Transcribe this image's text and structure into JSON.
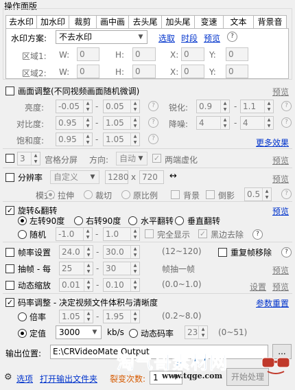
{
  "panel_title": "操作面版",
  "tabs": [
    "去水印",
    "加水印",
    "裁剪",
    "画中画",
    "去头尾",
    "加头尾",
    "变速",
    "文本",
    "背景音"
  ],
  "watermark_tab": {
    "scheme_label": "水印方案:",
    "scheme_value": "不去水印",
    "select_link": "选取",
    "time_link": "时段",
    "preview_link": "预览",
    "regions": [
      {
        "label": "区域1:",
        "w_label": "W:",
        "w": "0",
        "h_label": "H:",
        "h": "0",
        "x_label": "X:",
        "x": "0",
        "y_label": "Y:",
        "y": "0"
      },
      {
        "label": "区域2:",
        "w_label": "W:",
        "w": "0",
        "h_label": "H:",
        "h": "0",
        "x_label": "X:",
        "x": "0",
        "y_label": "Y:",
        "y": "0"
      }
    ]
  },
  "picture_adjust": {
    "label": "画面调整(不同视频画面随机微调)",
    "preview": "预览",
    "more": "更多效果",
    "brightness": {
      "label": "亮度:",
      "from": "-0.05",
      "to": "0.05"
    },
    "contrast": {
      "label": "对比度:",
      "from": "0.95",
      "to": "1.05"
    },
    "saturation": {
      "label": "饱和度:",
      "from": "0.95",
      "to": "1.05"
    },
    "sharpen": {
      "label": "锐化:",
      "from": "0.9",
      "to": "1.1"
    },
    "denoise": {
      "label": "降噪:",
      "from": "4",
      "to": "4"
    }
  },
  "grid_split": {
    "count": "3",
    "label": "宫格分屏",
    "direction_label": "方向:",
    "direction_value": "自动",
    "blur_label": "两端虚化",
    "preview": "预览"
  },
  "resolution": {
    "label": "分辨率",
    "preset": "自定义",
    "width": "1280",
    "times": "x",
    "height": "720",
    "preview": "预览",
    "mode_label": "模式:",
    "stretch": "拉伸",
    "crop": "裁切",
    "keep_ratio": "原比例",
    "background": "背景",
    "reflection": "倒影",
    "reflection_value": "0.5"
  },
  "rotate_flip": {
    "label": "旋转&翻转",
    "preview": "预览",
    "left90": "左转90度",
    "right90": "右转90度",
    "hflip": "水平翻转",
    "vflip": "垂直翻转",
    "random": "随机",
    "from": "-1.0",
    "to": "1.0",
    "full_display": "完全显示",
    "remove_black": "黑边去除"
  },
  "framerate": {
    "label": "帧率设置",
    "from": "24.0",
    "to": "30.0",
    "range": "(12~120)",
    "dup_remove": "重复帧移除"
  },
  "frame_drop": {
    "label": "抽帧 - 每",
    "from": "25",
    "to": "30",
    "suffix": "帧抽一帧",
    "preview": "预览"
  },
  "dynamic_zoom": {
    "label": "动态缩放",
    "from": "0.01",
    "to": "0.10",
    "range": "(0.0~1.0)",
    "settings": "设置",
    "preview": "预览"
  },
  "bitrate": {
    "label": "码率调整 - 决定视频文件体积与清晰度",
    "reset": "参数重置",
    "multiplier": "倍率",
    "mul_from": "1.05",
    "mul_to": "1.95",
    "mul_range": "(0.2~8.0)",
    "fixed": "定值",
    "fixed_value": "3000",
    "unit": "kb/s",
    "dynamic": "动态码率",
    "dynamic_value": "23",
    "dynamic_range": "(0~51)"
  },
  "output": {
    "label": "输出位置:",
    "path": "E:\\CRVideoMate Output",
    "browse": "..."
  },
  "footer": {
    "options": "选项",
    "open_folder": "打开输出文件夹",
    "split_label": "裂变次数:",
    "split_value": "1",
    "start": "开始处理"
  },
  "overlay": {
    "site": "淘气哥素材网",
    "url": "www.tqge.com"
  }
}
